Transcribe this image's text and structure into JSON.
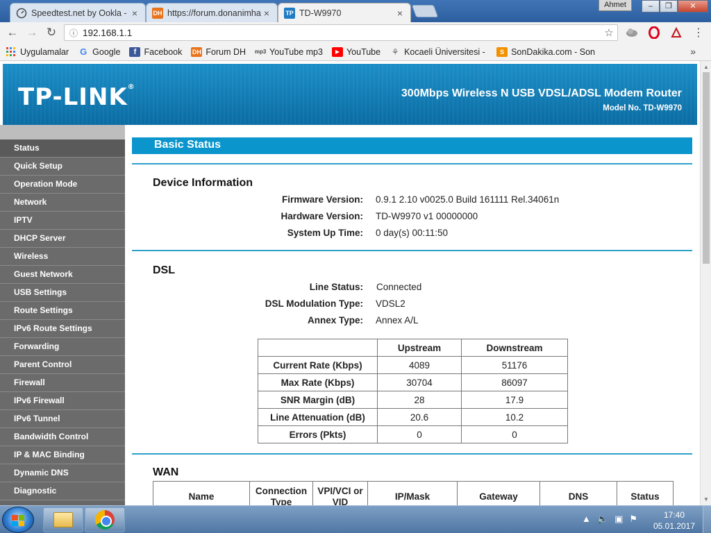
{
  "browser": {
    "tabs": [
      {
        "label": "Speedtest.net by Ookla -",
        "icon": "speedometer-icon"
      },
      {
        "label": "https://forum.donanimha",
        "icon": "DH"
      },
      {
        "label": "TD-W9970",
        "icon": "TP"
      }
    ],
    "profile": "Ahmet",
    "url": "192.168.1.1",
    "bookmarks": [
      {
        "label": "Uygulamalar",
        "color": "#e94235"
      },
      {
        "label": "Google",
        "color": "#4285f4"
      },
      {
        "label": "Facebook",
        "color": "#3b5998"
      },
      {
        "label": "Forum DH",
        "color": "#e8731a"
      },
      {
        "label": "YouTube mp3",
        "color": "#555555"
      },
      {
        "label": "YouTube",
        "color": "#ff0000"
      },
      {
        "label": "Kocaeli Üniversitesi - (",
        "color": "#6b6b6b"
      },
      {
        "label": "SonDakika.com - Son",
        "color": "#f29100"
      }
    ]
  },
  "router": {
    "logo": "TP-LINK",
    "logo_mark": "®",
    "product": "300Mbps Wireless N USB VDSL/ADSL Modem Router",
    "model": "Model No. TD-W9970",
    "menu": [
      "Status",
      "Quick Setup",
      "Operation Mode",
      "Network",
      "IPTV",
      "DHCP Server",
      "Wireless",
      "Guest Network",
      "USB Settings",
      "Route Settings",
      "IPv6 Route Settings",
      "Forwarding",
      "Parent Control",
      "Firewall",
      "IPv6 Firewall",
      "IPv6 Tunnel",
      "Bandwidth Control",
      "IP & MAC Binding",
      "Dynamic DNS",
      "Diagnostic"
    ],
    "page_title": "Basic Status",
    "device_info": {
      "title": "Device Information",
      "firmware_label": "Firmware Version:",
      "firmware": "0.9.1 2.10 v0025.0 Build 161111 Rel.34061n",
      "hardware_label": "Hardware Version:",
      "hardware": "TD-W9970 v1 00000000",
      "uptime_label": "System Up Time:",
      "uptime": "0 day(s) 00:11:50"
    },
    "dsl": {
      "title": "DSL",
      "line_status_label": "Line Status:",
      "line_status": "Connected",
      "modulation_label": "DSL Modulation Type:",
      "modulation": "VDSL2",
      "annex_label": "Annex Type:",
      "annex": "Annex A/L",
      "table": {
        "headers": [
          "",
          "Upstream",
          "Downstream"
        ],
        "rows": [
          [
            "Current Rate (Kbps)",
            "4089",
            "51176"
          ],
          [
            "Max Rate (Kbps)",
            "30704",
            "86097"
          ],
          [
            "SNR Margin (dB)",
            "28",
            "17.9"
          ],
          [
            "Line Attenuation (dB)",
            "20.6",
            "10.2"
          ],
          [
            "Errors (Pkts)",
            "0",
            "0"
          ]
        ]
      }
    },
    "wan": {
      "title": "WAN",
      "headers": [
        "Name",
        "Connection Type",
        "VPI/VCI or VID",
        "IP/Mask",
        "Gateway",
        "DNS",
        "Status"
      ]
    }
  },
  "taskbar": {
    "time": "17:40",
    "date": "05.01.2017"
  }
}
